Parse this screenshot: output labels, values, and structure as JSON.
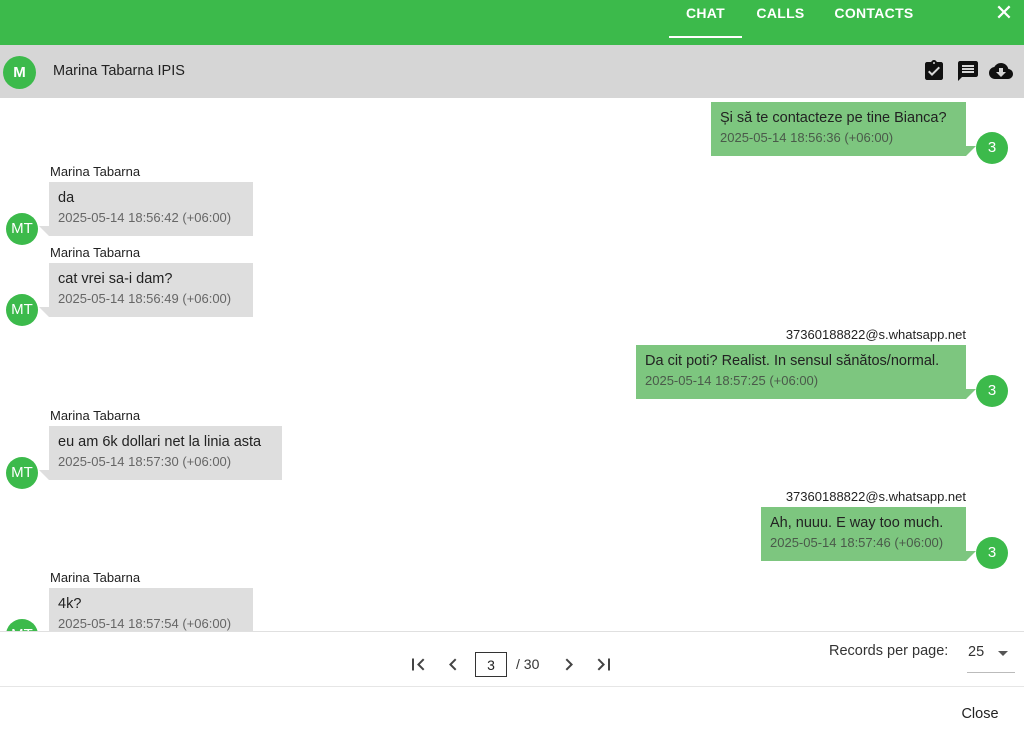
{
  "tabs": {
    "chat": "CHAT",
    "calls": "CALLS",
    "contacts": "CONTACTS"
  },
  "header": {
    "avatar_initial": "M",
    "title": "Marina Tabarna IPIS"
  },
  "messages": [
    {
      "direction": "out",
      "sender": "",
      "text": "Și să te contacteze pe tine Bianca?",
      "timestamp": "2025-05-14 18:56:36 (+06:00)",
      "avatar": "3"
    },
    {
      "direction": "in",
      "sender": "Marina Tabarna",
      "text": "da",
      "timestamp": "2025-05-14 18:56:42 (+06:00)",
      "avatar": "MT"
    },
    {
      "direction": "in",
      "sender": "Marina Tabarna",
      "text": "cat vrei sa-i dam?",
      "timestamp": "2025-05-14 18:56:49 (+06:00)",
      "avatar": "MT"
    },
    {
      "direction": "out",
      "sender": "37360188822@s.whatsapp.net",
      "text": "Da cit poti? Realist. In sensul sănătos/normal.",
      "timestamp": "2025-05-14 18:57:25 (+06:00)",
      "avatar": "3"
    },
    {
      "direction": "in",
      "sender": "Marina Tabarna",
      "text": "eu am 6k dollari net la linia asta",
      "timestamp": "2025-05-14 18:57:30 (+06:00)",
      "avatar": "MT"
    },
    {
      "direction": "out",
      "sender": "37360188822@s.whatsapp.net",
      "text": "Ah, nuuu. E way too much.",
      "timestamp": "2025-05-14 18:57:46 (+06:00)",
      "avatar": "3"
    },
    {
      "direction": "in",
      "sender": "Marina Tabarna",
      "text": "4k?",
      "timestamp": "2025-05-14 18:57:54 (+06:00)",
      "avatar": "MT"
    }
  ],
  "pagination": {
    "current_page": "3",
    "total_label": "/ 30",
    "records_label": "Records per page:",
    "records_value": "25"
  },
  "footer": {
    "close_label": "Close"
  },
  "colors": {
    "brand_green": "#3cba4b",
    "outgoing_bubble": "#7dc67f",
    "incoming_bubble": "#dedede",
    "subheader": "#d6d6d6"
  }
}
